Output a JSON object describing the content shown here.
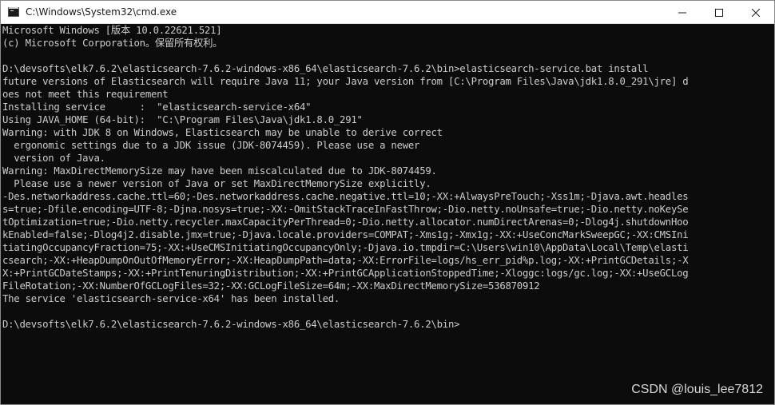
{
  "window": {
    "title": "C:\\Windows\\System32\\cmd.exe",
    "icons": {
      "app": "cmd-icon",
      "minimize": "minimize-icon",
      "maximize": "maximize-icon",
      "close": "close-icon"
    }
  },
  "terminal": {
    "lines": [
      "Microsoft Windows [版本 10.0.22621.521]",
      "(c) Microsoft Corporation。保留所有权利。",
      "",
      "D:\\devsofts\\elk7.6.2\\elasticsearch-7.6.2-windows-x86_64\\elasticsearch-7.6.2\\bin>elasticsearch-service.bat install",
      "future versions of Elasticsearch will require Java 11; your Java version from [C:\\Program Files\\Java\\jdk1.8.0_291\\jre] d",
      "oes not meet this requirement",
      "Installing service      :  \"elasticsearch-service-x64\"",
      "Using JAVA_HOME (64-bit):  \"C:\\Program Files\\Java\\jdk1.8.0_291\"",
      "Warning: with JDK 8 on Windows, Elasticsearch may be unable to derive correct",
      "  ergonomic settings due to a JDK issue (JDK-8074459). Please use a newer",
      "  version of Java.",
      "Warning: MaxDirectMemorySize may have been miscalculated due to JDK-8074459.",
      "  Please use a newer version of Java or set MaxDirectMemorySize explicitly.",
      "-Des.networkaddress.cache.ttl=60;-Des.networkaddress.cache.negative.ttl=10;-XX:+AlwaysPreTouch;-Xss1m;-Djava.awt.headles",
      "s=true;-Dfile.encoding=UTF-8;-Djna.nosys=true;-XX:-OmitStackTraceInFastThrow;-Dio.netty.noUnsafe=true;-Dio.netty.noKeySe",
      "tOptimization=true;-Dio.netty.recycler.maxCapacityPerThread=0;-Dio.netty.allocator.numDirectArenas=0;-Dlog4j.shutdownHoo",
      "kEnabled=false;-Dlog4j2.disable.jmx=true;-Djava.locale.providers=COMPAT;-Xms1g;-Xmx1g;-XX:+UseConcMarkSweepGC;-XX:CMSIni",
      "tiatingOccupancyFraction=75;-XX:+UseCMSInitiatingOccupancyOnly;-Djava.io.tmpdir=C:\\Users\\win10\\AppData\\Local\\Temp\\elasti",
      "csearch;-XX:+HeapDumpOnOutOfMemoryError;-XX:HeapDumpPath=data;-XX:ErrorFile=logs/hs_err_pid%p.log;-XX:+PrintGCDetails;-X",
      "X:+PrintGCDateStamps;-XX:+PrintTenuringDistribution;-XX:+PrintGCApplicationStoppedTime;-Xloggc:logs/gc.log;-XX:+UseGCLog",
      "FileRotation;-XX:NumberOfGCLogFiles=32;-XX:GCLogFileSize=64m;-XX:MaxDirectMemorySize=536870912",
      "The service 'elasticsearch-service-x64' has been installed.",
      "",
      "D:\\devsofts\\elk7.6.2\\elasticsearch-7.6.2-windows-x86_64\\elasticsearch-7.6.2\\bin>"
    ]
  },
  "watermark": {
    "text": "CSDN @louis_lee7812"
  },
  "colors": {
    "terminal_bg": "#0c0c0c",
    "terminal_fg": "#cccccc",
    "titlebar_bg": "#ffffff"
  }
}
